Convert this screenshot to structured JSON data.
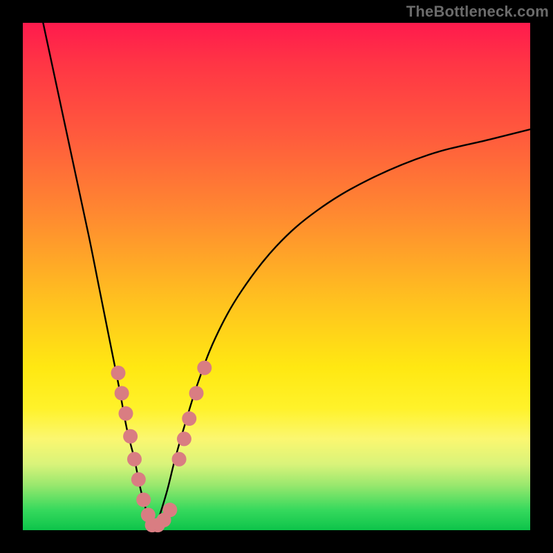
{
  "watermark": "TheBottleneck.com",
  "chart_data": {
    "type": "line",
    "title": "",
    "xlabel": "",
    "ylabel": "",
    "xlim": [
      0,
      100
    ],
    "ylim": [
      0,
      100
    ],
    "note": "Bottleneck V-curve heatmap. Axes unlabeled; values are estimated relative positions (percent of plot area).",
    "series": [
      {
        "name": "left-curve",
        "x": [
          4,
          7,
          10,
          13,
          15,
          17,
          19,
          20.5,
          22,
          23,
          24,
          25,
          26
        ],
        "y": [
          100,
          86,
          72,
          58,
          48,
          38,
          28,
          20,
          14,
          9,
          5,
          2,
          0
        ]
      },
      {
        "name": "right-curve",
        "x": [
          26,
          27,
          28.5,
          30,
          32,
          34.5,
          38,
          43,
          50,
          58,
          68,
          80,
          92,
          100
        ],
        "y": [
          0,
          3,
          8,
          14,
          21,
          29,
          38,
          47,
          56,
          63,
          69,
          74,
          77,
          79
        ]
      }
    ],
    "markers": [
      {
        "name": "left-branch-dots",
        "color": "#d97d82",
        "points": [
          {
            "x": 18.8,
            "y": 31
          },
          {
            "x": 19.5,
            "y": 27
          },
          {
            "x": 20.3,
            "y": 23
          },
          {
            "x": 21.2,
            "y": 18.5
          },
          {
            "x": 22.0,
            "y": 14
          },
          {
            "x": 22.8,
            "y": 10
          },
          {
            "x": 23.8,
            "y": 6
          },
          {
            "x": 24.7,
            "y": 3
          }
        ]
      },
      {
        "name": "valley-dots",
        "color": "#d97d82",
        "points": [
          {
            "x": 25.5,
            "y": 1
          },
          {
            "x": 26.6,
            "y": 1
          },
          {
            "x": 27.8,
            "y": 2
          },
          {
            "x": 29.0,
            "y": 4
          }
        ]
      },
      {
        "name": "right-branch-dots",
        "color": "#d97d82",
        "points": [
          {
            "x": 30.8,
            "y": 14
          },
          {
            "x": 31.8,
            "y": 18
          },
          {
            "x": 32.8,
            "y": 22
          },
          {
            "x": 34.2,
            "y": 27
          },
          {
            "x": 35.8,
            "y": 32
          }
        ]
      }
    ]
  }
}
